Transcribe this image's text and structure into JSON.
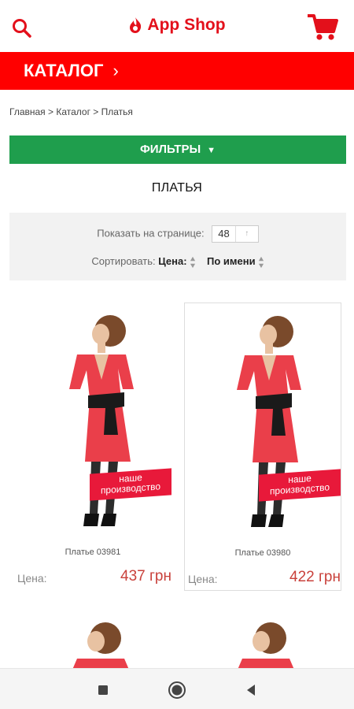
{
  "header": {
    "app_title": "App Shop",
    "icons": {
      "search": "search-icon",
      "cart": "cart-icon",
      "logo": "flame-logo-icon"
    }
  },
  "catalog_bar": {
    "label": "КАТАЛОГ",
    "chevron": "›"
  },
  "breadcrumb": "Главная > Каталог > Платья",
  "filters": {
    "label": "ФИЛЬТРЫ",
    "arrow": "⌄"
  },
  "page_title": "ПЛАТЬЯ",
  "toolbox": {
    "per_page_label": "Показать на странице:",
    "per_page_value": "48",
    "sort_label": "Сортировать:",
    "sort_price": "Цена:",
    "sort_name": "По имени"
  },
  "products": [
    {
      "name": "Платье 03981",
      "price_label": "Цена:",
      "price": "437 грн",
      "ribbon": "наше производство"
    },
    {
      "name": "Платье 03980",
      "price_label": "Цена:",
      "price": "422 грн",
      "ribbon": "наше производство"
    }
  ],
  "colors": {
    "brand_red": "#ff0000",
    "filter_green": "#1f9e4d",
    "price_red": "#c9413b",
    "ribbon_red": "#e8193a"
  }
}
